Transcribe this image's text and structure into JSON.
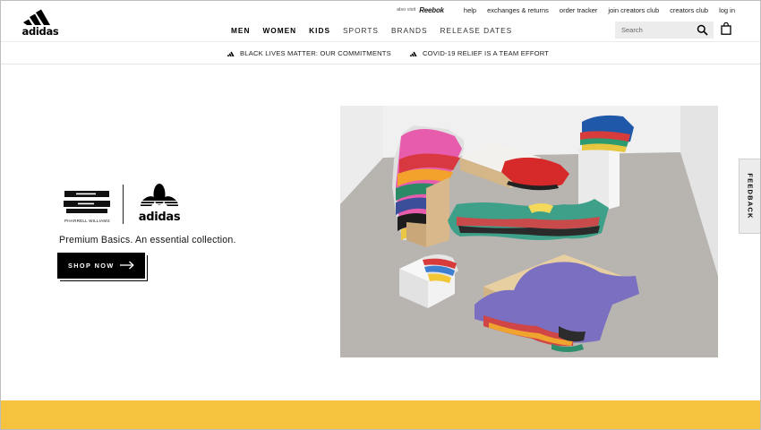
{
  "header": {
    "logo_text": "adidas",
    "also_visit_text": "also visit",
    "partner_brand": "Reebok",
    "utility_links": [
      "help",
      "exchanges & returns",
      "order tracker",
      "join creators club",
      "creators club",
      "log in"
    ],
    "nav_items": [
      "MEN",
      "WOMEN",
      "KIDS",
      "SPORTS",
      "BRANDS",
      "RELEASE DATES"
    ],
    "search_placeholder": "Search",
    "icons": [
      "search-icon",
      "shopping-bag-icon"
    ]
  },
  "announcements": [
    "BLACK LIVES MATTER: OUR COMMITMENTS",
    "COVID-19 RELIEF IS A TEAM EFFORT"
  ],
  "hero": {
    "collab_name": "PHARRELL WILLIAMS",
    "brand_name": "adidas",
    "tagline": "Premium Basics. An essential collection.",
    "cta_label": "SHOP NOW",
    "cta_icon": "arrow-right-icon"
  },
  "feedback_tab": "FEEDBACK",
  "colors": {
    "brand_black": "#000000",
    "band_yellow": "#f6c33f",
    "search_bg": "#ececec"
  }
}
